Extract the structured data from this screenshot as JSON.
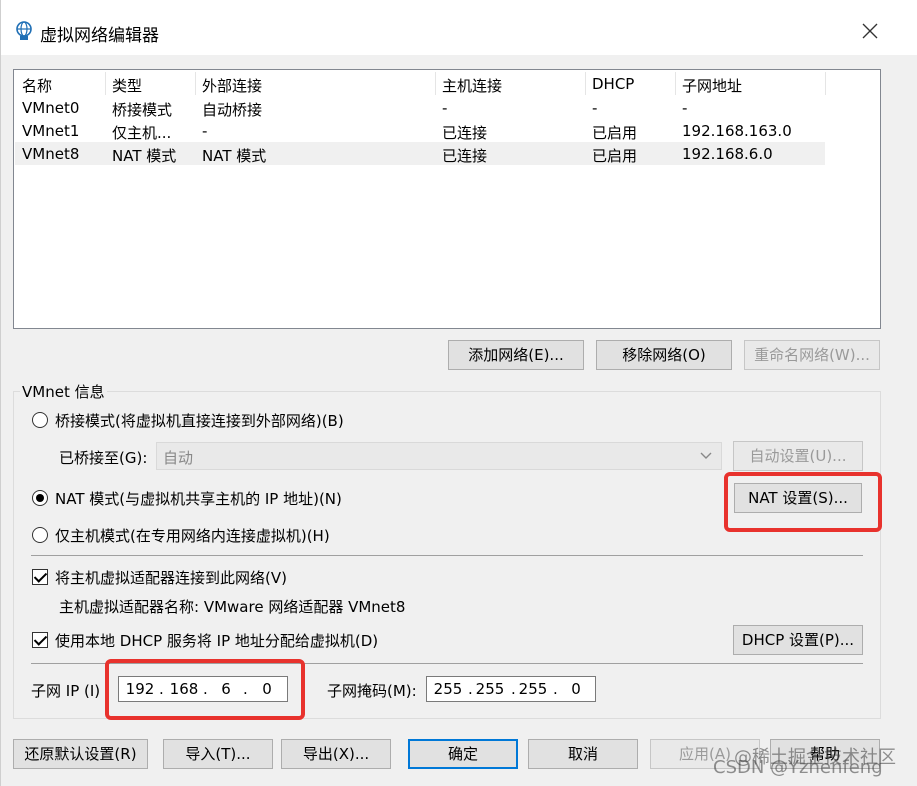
{
  "window": {
    "title": "虚拟网络编辑器"
  },
  "table": {
    "columns": [
      "名称",
      "类型",
      "外部连接",
      "主机连接",
      "DHCP",
      "子网地址"
    ],
    "rows": [
      [
        "VMnet0",
        "桥接模式",
        "自动桥接",
        "-",
        "-",
        "-"
      ],
      [
        "VMnet1",
        "仅主机...",
        "-",
        "已连接",
        "已启用",
        "192.168.163.0"
      ],
      [
        "VMnet8",
        "NAT 模式",
        "NAT 模式",
        "已连接",
        "已启用",
        "192.168.6.0"
      ]
    ],
    "selected_row": 2
  },
  "network_buttons": {
    "add": "添加网络(E)...",
    "remove": "移除网络(O)",
    "rename": "重命名网络(W)..."
  },
  "vmnet_info": {
    "group_label": "VMnet 信息",
    "bridged_radio": "桥接模式(将虚拟机直接连接到外部网络)(B)",
    "bridged_to_label": "已桥接至(G):",
    "bridged_to_value": "自动",
    "auto_settings": "自动设置(U)...",
    "nat_radio": "NAT 模式(与虚拟机共享主机的 IP 地址)(N)",
    "nat_settings": "NAT 设置(S)...",
    "hostonly_radio": "仅主机模式(在专用网络内连接虚拟机)(H)",
    "selected_mode": "nat",
    "connect_adapter_check": "将主机虚拟适配器连接到此网络(V)",
    "connect_adapter_checked": true,
    "adapter_name_label": "主机虚拟适配器名称: VMware 网络适配器 VMnet8",
    "dhcp_check": "使用本地 DHCP 服务将 IP 地址分配给虚拟机(D)",
    "dhcp_checked": true,
    "dhcp_settings": "DHCP 设置(P)...",
    "subnet_ip_label": "子网 IP (I)",
    "subnet_ip": [
      "192",
      "168",
      "6",
      "0"
    ],
    "subnet_mask_label": "子网掩码(M):",
    "subnet_mask": [
      "255",
      "255",
      "255",
      "0"
    ]
  },
  "footer": {
    "restore": "还原默认设置(R)",
    "import": "导入(T)...",
    "export": "导出(X)...",
    "ok": "确定",
    "cancel": "取消",
    "apply": "应用(A)",
    "help": "帮助"
  },
  "watermark": {
    "line1": "@稀土掘金技术社区",
    "line2": "CSDN @Yzhenfeng"
  },
  "colors": {
    "highlight": "#e8322d",
    "focus": "#0078d7",
    "selected_row": "#f0f0f0"
  }
}
